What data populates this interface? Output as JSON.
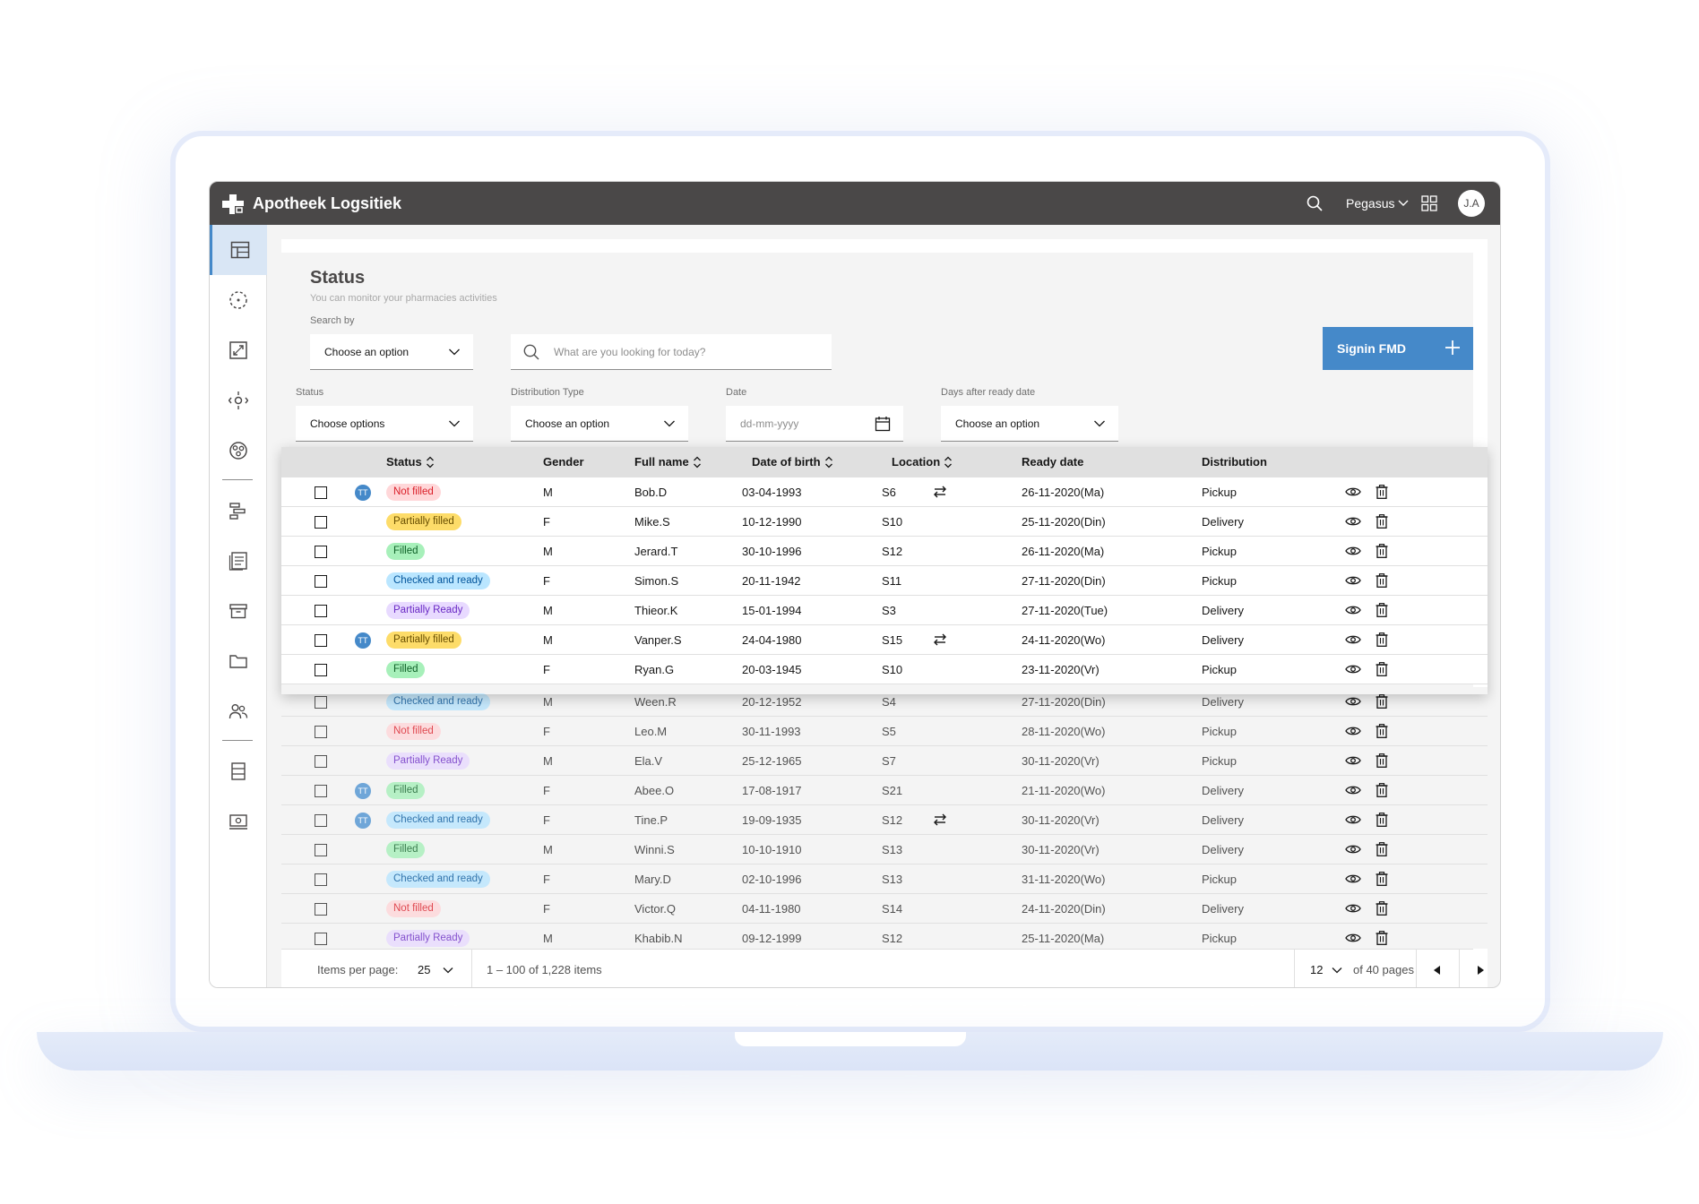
{
  "app": {
    "title": "Apotheek Logsitiek",
    "user_menu": "Pegasus",
    "avatar_initials": "J.A"
  },
  "page": {
    "title": "Status",
    "subtitle": "You can monitor your pharmacies activities"
  },
  "filters": {
    "search_by_label": "Search by",
    "search_by_value": "Choose an option",
    "search_placeholder": "What are you looking for today?",
    "status_label": "Status",
    "status_value": "Choose options",
    "distribution_label": "Distribution Type",
    "distribution_value": "Choose an option",
    "date_label": "Date",
    "date_placeholder": "dd-mm-yyyy",
    "days_label": "Days after ready date",
    "days_value": "Choose an option"
  },
  "signin_button": "Signin FMD",
  "table": {
    "headers": {
      "status": "Status",
      "gender": "Gender",
      "full_name": "Full name",
      "dob": "Date of birth",
      "location": "Location",
      "ready_date": "Ready date",
      "distribution": "Distribution"
    },
    "tt_badge": "TT",
    "rows": [
      {
        "tt": true,
        "status": "Not filled",
        "tag": "not",
        "gender": "M",
        "name": "Bob.D",
        "dob": "03-04-1993",
        "loc": "S6",
        "swap": true,
        "ready": "26-11-2020(Ma)",
        "dist": "Pickup"
      },
      {
        "tt": false,
        "status": "Partially filled",
        "tag": "part",
        "gender": "F",
        "name": "Mike.S",
        "dob": "10-12-1990",
        "loc": "S10",
        "swap": false,
        "ready": "25-11-2020(Din)",
        "dist": "Delivery"
      },
      {
        "tt": false,
        "status": "Filled",
        "tag": "filled",
        "gender": "M",
        "name": "Jerard.T",
        "dob": "30-10-1996",
        "loc": "S12",
        "swap": false,
        "ready": "26-11-2020(Ma)",
        "dist": "Pickup"
      },
      {
        "tt": false,
        "status": "Checked and ready",
        "tag": "checked",
        "gender": "F",
        "name": "Simon.S",
        "dob": "20-11-1942",
        "loc": "S11",
        "swap": false,
        "ready": "27-11-2020(Din)",
        "dist": "Pickup"
      },
      {
        "tt": false,
        "status": "Partially Ready",
        "tag": "ready",
        "gender": "M",
        "name": "Thieor.K",
        "dob": "15-01-1994",
        "loc": "S3",
        "swap": false,
        "ready": "27-11-2020(Tue)",
        "dist": "Delivery"
      },
      {
        "tt": true,
        "status": "Partially filled",
        "tag": "part",
        "gender": "M",
        "name": "Vanper.S",
        "dob": "24-04-1980",
        "loc": "S15",
        "swap": true,
        "ready": "24-11-2020(Wo)",
        "dist": "Delivery"
      },
      {
        "tt": false,
        "status": "Filled",
        "tag": "filled",
        "gender": "F",
        "name": "Ryan.G",
        "dob": "20-03-1945",
        "loc": "S10",
        "swap": false,
        "ready": "23-11-2020(Vr)",
        "dist": "Pickup"
      },
      {
        "tt": false,
        "status": "Checked and ready",
        "tag": "checked",
        "gender": "M",
        "name": "Ween.R",
        "dob": "20-12-1952",
        "loc": "S4",
        "swap": false,
        "ready": "27-11-2020(Din)",
        "dist": "Delivery"
      },
      {
        "tt": false,
        "status": "Not filled",
        "tag": "not",
        "gender": "F",
        "name": "Leo.M",
        "dob": "30-11-1993",
        "loc": "S5",
        "swap": false,
        "ready": "28-11-2020(Wo)",
        "dist": "Pickup"
      },
      {
        "tt": false,
        "status": "Partially Ready",
        "tag": "ready",
        "gender": "M",
        "name": "Ela.V",
        "dob": "25-12-1965",
        "loc": "S7",
        "swap": false,
        "ready": "30-11-2020(Vr)",
        "dist": "Pickup"
      },
      {
        "tt": true,
        "status": "Filled",
        "tag": "filled",
        "gender": "F",
        "name": "Abee.O",
        "dob": "17-08-1917",
        "loc": "S21",
        "swap": false,
        "ready": "21-11-2020(Wo)",
        "dist": "Delivery"
      },
      {
        "tt": true,
        "status": "Checked and ready",
        "tag": "checked",
        "gender": "F",
        "name": "Tine.P",
        "dob": "19-09-1935",
        "loc": "S12",
        "swap": true,
        "ready": "30-11-2020(Vr)",
        "dist": "Delivery"
      },
      {
        "tt": false,
        "status": "Filled",
        "tag": "filled",
        "gender": "M",
        "name": "Winni.S",
        "dob": "10-10-1910",
        "loc": "S13",
        "swap": false,
        "ready": "30-11-2020(Vr)",
        "dist": "Delivery"
      },
      {
        "tt": false,
        "status": "Checked and ready",
        "tag": "checked",
        "gender": "F",
        "name": "Mary.D",
        "dob": "02-10-1996",
        "loc": "S13",
        "swap": false,
        "ready": "31-11-2020(Wo)",
        "dist": "Pickup"
      },
      {
        "tt": false,
        "status": "Not filled",
        "tag": "not",
        "gender": "F",
        "name": "Victor.Q",
        "dob": "04-11-1980",
        "loc": "S14",
        "swap": false,
        "ready": "24-11-2020(Din)",
        "dist": "Delivery"
      },
      {
        "tt": false,
        "status": "Partially Ready",
        "tag": "ready",
        "gender": "M",
        "name": "Khabib.N",
        "dob": "09-12-1999",
        "loc": "S12",
        "swap": false,
        "ready": "25-11-2020(Ma)",
        "dist": "Pickup"
      }
    ]
  },
  "pagination": {
    "items_per_page_label": "Items per page:",
    "items_per_page_value": "25",
    "range_text": "1 – 100 of 1,228 items",
    "current_page": "12",
    "total_pages_text": "of 40 pages"
  },
  "colors": {
    "header_bg": "#4a4848",
    "accent": "#4589c9"
  }
}
